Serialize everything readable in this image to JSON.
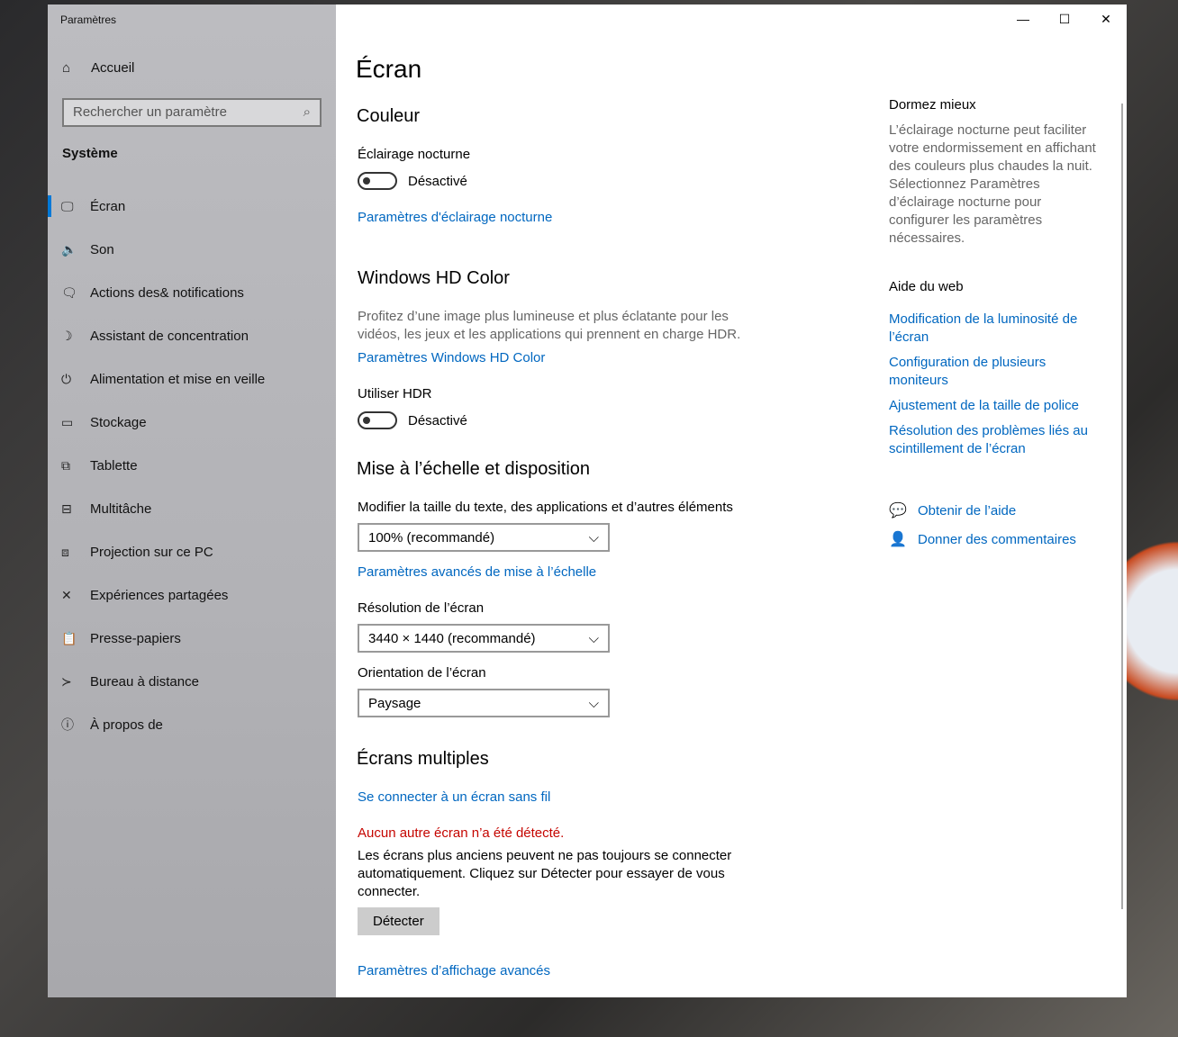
{
  "window": {
    "title": "Paramètres"
  },
  "sidebar": {
    "home": "Accueil",
    "search_placeholder": "Rechercher un paramètre",
    "section": "Système",
    "items": [
      {
        "label": "Écran",
        "icon": "🖵"
      },
      {
        "label": "Son",
        "icon": "🔈"
      },
      {
        "label": "Actions des& notifications",
        "icon": "🗨"
      },
      {
        "label": "Assistant de concentration",
        "icon": "☽"
      },
      {
        "label": "Alimentation et mise en veille",
        "icon": "⏻"
      },
      {
        "label": "Stockage",
        "icon": "▭"
      },
      {
        "label": "Tablette",
        "icon": "⧉"
      },
      {
        "label": "Multitâche",
        "icon": "⊟"
      },
      {
        "label": "Projection sur ce PC",
        "icon": "⧈"
      },
      {
        "label": "Expériences partagées",
        "icon": "✕"
      },
      {
        "label": "Presse-papiers",
        "icon": "📋"
      },
      {
        "label": "Bureau à distance",
        "icon": "≻"
      },
      {
        "label": "À propos de",
        "icon": "ⓘ"
      }
    ]
  },
  "main": {
    "title": "Écran",
    "color": {
      "heading": "Couleur",
      "night_label": "Éclairage nocturne",
      "night_state": "Désactivé",
      "night_link": "Paramètres d'éclairage nocturne"
    },
    "hd": {
      "heading": "Windows HD Color",
      "desc": "Profitez d’une image plus lumineuse et plus éclatante pour les vidéos, les jeux et les applications qui prennent en charge HDR.",
      "link": "Paramètres Windows HD Color",
      "hdr_label": "Utiliser HDR",
      "hdr_state": "Désactivé"
    },
    "scale": {
      "heading": "Mise à l’échelle et disposition",
      "size_label": "Modifier la taille du texte, des applications et d’autres éléments",
      "size_value": "100% (recommandé)",
      "adv_link": "Paramètres avancés de mise à l’échelle",
      "res_label": "Résolution de l’écran",
      "res_value": "3440 × 1440 (recommandé)",
      "orient_label": "Orientation de l’écran",
      "orient_value": "Paysage"
    },
    "multi": {
      "heading": "Écrans multiples",
      "wireless_link": "Se connecter à un écran sans fil",
      "error": "Aucun autre écran n’a été détecté.",
      "desc": "Les écrans plus anciens peuvent ne pas toujours se connecter automatiquement. Cliquez sur Détecter pour essayer de vous connecter.",
      "detect": "Détecter",
      "adv_link": "Paramètres d’affichage avancés"
    }
  },
  "aside": {
    "sleep_title": "Dormez mieux",
    "sleep_desc": "L’éclairage nocturne peut faciliter votre endormissement en affichant des couleurs plus chaudes la nuit. Sélectionnez Paramètres d’éclairage nocturne pour configurer les paramètres nécessaires.",
    "web_title": "Aide du web",
    "links": [
      "Modification de la luminosité de l’écran",
      "Configuration de plusieurs moniteurs",
      "Ajustement de la taille de police",
      "Résolution des problèmes liés au scintillement de l’écran"
    ],
    "help": "Obtenir de l’aide",
    "feedback": "Donner des commentaires"
  }
}
